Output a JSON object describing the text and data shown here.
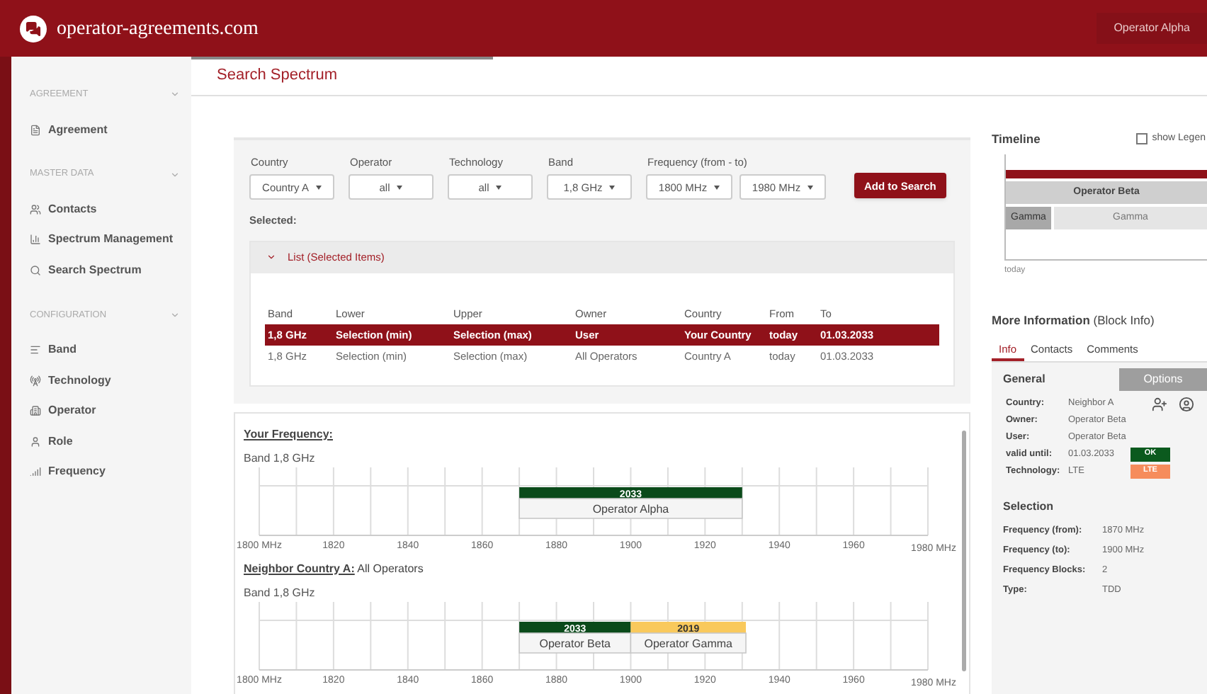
{
  "header": {
    "site": "operator-agreements.com",
    "user_button": "Operator Alpha"
  },
  "sidebar": [
    {
      "title": "AGREEMENT",
      "expanded": true,
      "items": [
        {
          "label": "Agreement"
        }
      ]
    },
    {
      "title": "MASTER DATA",
      "expanded": true,
      "items": [
        {
          "label": "Contacts"
        },
        {
          "label": "Spectrum Management"
        },
        {
          "label": "Search Spectrum"
        }
      ]
    },
    {
      "title": "CONFIGURATION",
      "expanded": true,
      "items": [
        {
          "label": "Band"
        },
        {
          "label": "Technology"
        },
        {
          "label": "Operator"
        },
        {
          "label": "Role"
        },
        {
          "label": "Frequency"
        }
      ]
    }
  ],
  "page_title": "Search Spectrum",
  "filters": [
    {
      "label": "Country",
      "value": "Country A"
    },
    {
      "label": "Operator",
      "value": "all"
    },
    {
      "label": "Technology",
      "value": "all"
    },
    {
      "label": "Band",
      "value": "1,8 GHz"
    }
  ],
  "frequency_filter": {
    "label": "Frequency (from - to)",
    "from": "1800 MHz",
    "to": "1980 MHz"
  },
  "add_button": "Add to Search",
  "selected_label": "Selected:",
  "list_panel": {
    "title": "List (Selected Items)",
    "expanded": true,
    "columns": [
      "Band",
      "Lower",
      "Upper",
      "Owner",
      "Country",
      "From",
      "To"
    ],
    "rows": [
      {
        "cells": [
          "1,8 GHz",
          "Selection (min)",
          "Selection (max)",
          "User",
          "Your Country",
          "today",
          "01.03.2033"
        ],
        "selected": true
      },
      {
        "cells": [
          "1,8 GHz",
          "Selection (min)",
          "Selection (max)",
          "All Operators",
          "Country A",
          "today",
          "01.03.2033"
        ],
        "selected": false
      }
    ]
  },
  "charts": [
    {
      "heading": "Your Frequency:",
      "band": "Band 1,8 GHz",
      "ticks": [
        "1800 MHz",
        "1820",
        "1840",
        "1860",
        "1880",
        "1900",
        "1920",
        "1940",
        "1960",
        "1980 MHz"
      ],
      "blocks": [
        {
          "year": "2033",
          "operator": "Operator Alpha",
          "color": "#0a4a1a"
        }
      ]
    },
    {
      "heading": "Neighbor Country A:",
      "suffix": "All Operators",
      "band": "Band 1,8 GHz",
      "ticks": [
        "1800 MHz",
        "1820",
        "1840",
        "1860",
        "1880",
        "1900",
        "1920",
        "1940",
        "1960",
        "1980 MHz"
      ],
      "blocks": [
        {
          "year": "2033",
          "operator": "Operator Beta",
          "color": "#0a4a1a"
        },
        {
          "year": "2019",
          "operator": "Operator Gamma",
          "color": "#f9c95c"
        }
      ]
    }
  ],
  "timeline": {
    "title": "Timeline",
    "legend": {
      "label": "show Legen",
      "checked": false
    },
    "operator_bar": "Operator Beta",
    "rows": [
      {
        "label": "Gamma"
      },
      {
        "label": "Gamma"
      }
    ],
    "axis_label": "today"
  },
  "info": {
    "title": "More Information",
    "suffix": "(Block Info)",
    "tabs": [
      {
        "label": "Info",
        "selected": true
      },
      {
        "label": "Contacts",
        "selected": false
      },
      {
        "label": "Comments",
        "selected": false
      }
    ],
    "general_title": "General",
    "options_button": "Options",
    "general": [
      {
        "label": "Country:",
        "value": "Neighbor A"
      },
      {
        "label": "Owner:",
        "value": "Operator Beta"
      },
      {
        "label": "User:",
        "value": "Operator Beta"
      },
      {
        "label": "valid until:",
        "value": "01.03.2033",
        "badge": {
          "text": "OK",
          "color": "#0b5a1e"
        }
      },
      {
        "label": "Technology:",
        "value": "LTE",
        "badge": {
          "text": "LTE",
          "color": "#f68c5c"
        }
      }
    ],
    "selection_title": "Selection",
    "selection": [
      {
        "label": "Frequency (from):",
        "value": "1870 MHz"
      },
      {
        "label": "Frequency (to):",
        "value": "1900 MHz"
      },
      {
        "label": "Frequency Blocks:",
        "value": "2"
      },
      {
        "label": "Type:",
        "value": "TDD"
      }
    ]
  }
}
